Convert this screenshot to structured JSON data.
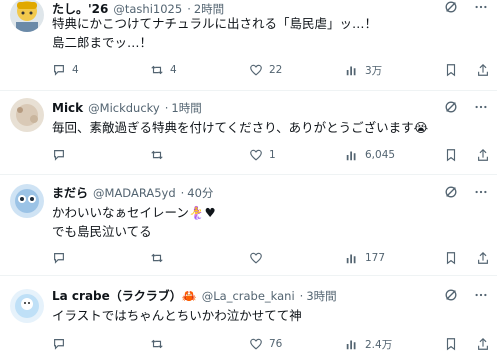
{
  "posts": [
    {
      "name": "たし。'26",
      "handle": "@tashi1025",
      "time": "2時間",
      "lines": [
        "特典にかこつけてナチュラルに出される「島民虐」ッ…！",
        "島二郎までッ…！"
      ],
      "replies": "4",
      "reposts": "4",
      "likes": "22",
      "views": "3万"
    },
    {
      "name": "Mick",
      "handle": "@Mickducky",
      "time": "1時間",
      "lines": [
        "毎回、素敵過ぎる特典を付けてくださり、ありがとうございます😭"
      ],
      "replies": "",
      "reposts": "",
      "likes": "1",
      "views": "6,045"
    },
    {
      "name": "まだら",
      "handle": "@MADARA5yd",
      "time": "40分",
      "lines": [
        "かわいいなぁセイレーン🧜‍♀️♥",
        "でも島民泣いてる"
      ],
      "replies": "",
      "reposts": "",
      "likes": "",
      "views": "177"
    },
    {
      "name": "La crabe（ラクラブ）🦀",
      "handle": "@La_crabe_kani",
      "time": "3時間",
      "lines": [
        "イラストではちゃんとちいかわ泣かせてて神"
      ],
      "replies": "",
      "reposts": "",
      "likes": "76",
      "views": "2.4万"
    }
  ],
  "colors": {
    "text": "#0f1419",
    "muted": "#536471",
    "divider": "#eff3f4"
  },
  "icons": [
    "grok-icon",
    "more-icon",
    "reply-icon",
    "repost-icon",
    "like-icon",
    "views-icon",
    "bookmark-icon",
    "share-icon"
  ]
}
